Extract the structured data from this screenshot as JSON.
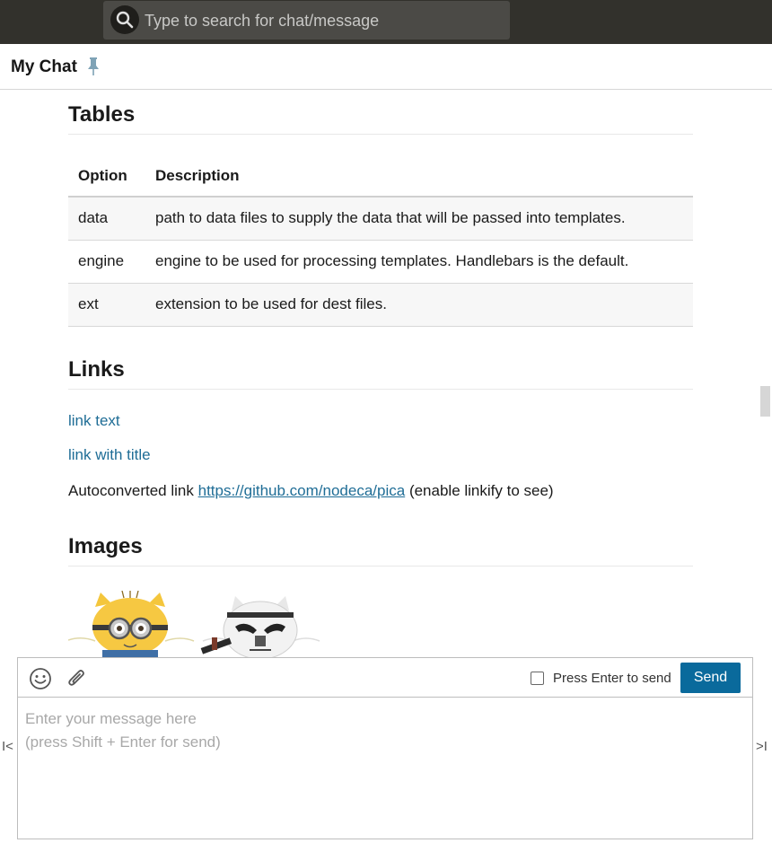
{
  "search": {
    "placeholder": "Type to search for chat/message"
  },
  "header": {
    "title": "My Chat"
  },
  "doc": {
    "tables_heading": "Tables",
    "table": {
      "headers": [
        "Option",
        "Description"
      ],
      "rows": [
        [
          "data",
          "path to data files to supply the data that will be passed into templates."
        ],
        [
          "engine",
          "engine to be used for processing templates. Handlebars is the default."
        ],
        [
          "ext",
          "extension to be used for dest files."
        ]
      ]
    },
    "links_heading": "Links",
    "link_text": "link text",
    "link_with_title": "link with title",
    "autoconverted_prefix": "Autoconverted link",
    "autoconverted_url": "https://github.com/nodeca/pica",
    "autoconverted_suffix": "(enable linkify to see)",
    "images_heading": "Images"
  },
  "composer": {
    "press_enter_label": "Press Enter to send",
    "send_label": "Send",
    "message_placeholder": "Enter your message here\n(press Shift + Enter for send)"
  },
  "colors": {
    "topbar": "#32312c",
    "link": "#1f6d96",
    "send": "#0a6a9c"
  }
}
